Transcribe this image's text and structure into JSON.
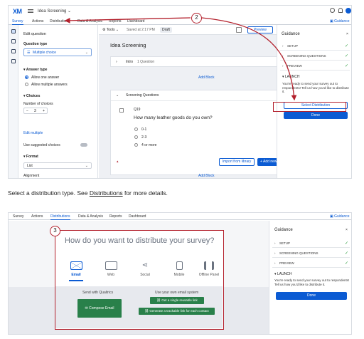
{
  "shot1": {
    "logo": "XM",
    "project_title": "Idea Screening",
    "tabs": [
      "Survey",
      "Actions",
      "Distributions",
      "Data & Analysis",
      "Reports",
      "Dashboard"
    ],
    "guidance_link": "Guidance",
    "edit_panel": {
      "title": "Edit question",
      "question_type_label": "Question type",
      "question_type_value": "Multiple choice",
      "answer_type_label": "Answer type",
      "answer_options": [
        "Allow one answer",
        "Allow multiple answers"
      ],
      "choices_label": "Choices",
      "num_choices_label": "Number of choices",
      "num_choices_value": "3",
      "edit_multiple": "Edit multiple",
      "use_suggested": "Use suggested choices",
      "format_label": "Format",
      "format_value": "List",
      "alignment_label": "Alignment"
    },
    "toolbar": {
      "tools": "Tools",
      "saved": "Saved at 2:17 PM",
      "draft": "Draft",
      "preview": "Preview"
    },
    "survey_title": "Idea Screening",
    "intro_block": {
      "name": "Intro",
      "count": "1 Question"
    },
    "add_block": "Add Block",
    "screening_block": {
      "name": "Screening Questions"
    },
    "question": {
      "id": "Q19",
      "text": "How many leather goods do you own?",
      "choices": [
        "0-1",
        "2-3",
        "4 or more"
      ]
    },
    "import_library": "Import from library",
    "add_new": "+ Add new",
    "guidance": {
      "title": "Guidance",
      "rows": [
        "SETUP",
        "SCREENING QUESTIONS",
        "PREVIEW"
      ],
      "launch": "LAUNCH",
      "launch_text": "You're ready to send your survey out to respondents! Tell us how you'd like to distribute it.",
      "select_distribution": "Select Distribution",
      "done": "Done"
    },
    "callout": "2"
  },
  "caption": {
    "before": "Select a distribution type. See ",
    "link": "Distributions",
    "after": " for more details."
  },
  "shot2": {
    "tabs": [
      "Survey",
      "Actions",
      "Distributions",
      "Data & Analysis",
      "Reports",
      "Dashboard"
    ],
    "guidance_link": "Guidance",
    "heading": "How do you want to distribute your survey?",
    "methods": [
      "Email",
      "Web",
      "Social",
      "Mobile",
      "Offline Panel"
    ],
    "send_with": "Send with Qualtrics",
    "compose_email": "Compose Email",
    "own_email": "Use your own email system",
    "single_link": "Get a single reusable link",
    "trackable_link": "Generate a trackable link for each contact",
    "guidance": {
      "title": "Guidance",
      "rows": [
        "SETUP",
        "SCREENING QUESTIONS",
        "PREVIEW"
      ],
      "launch": "LAUNCH",
      "launch_text": "You're ready to send your survey out to respondents! Tell us how you'd like to distribute it.",
      "done": "Done"
    },
    "callout": "3"
  },
  "colors": {
    "accent": "#0b5bd3",
    "annotation": "#b3202c",
    "success": "#2e9d3e",
    "qualtrics_green": "#29804a"
  }
}
